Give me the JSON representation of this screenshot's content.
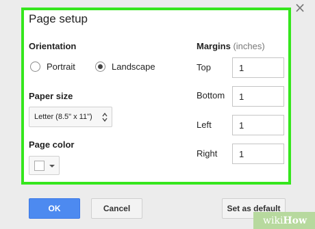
{
  "dialog": {
    "title": "Page setup",
    "close_icon": "close-icon"
  },
  "orientation": {
    "label": "Orientation",
    "options": [
      {
        "label": "Portrait",
        "checked": false
      },
      {
        "label": "Landscape",
        "checked": true
      }
    ]
  },
  "paper_size": {
    "label": "Paper size",
    "selected": "Letter (8.5\" x 11\")"
  },
  "page_color": {
    "label": "Page color",
    "value": "#ffffff"
  },
  "margins": {
    "label": "Margins",
    "unit": "(inches)",
    "fields": [
      {
        "label": "Top",
        "value": "1"
      },
      {
        "label": "Bottom",
        "value": "1"
      },
      {
        "label": "Left",
        "value": "1"
      },
      {
        "label": "Right",
        "value": "1"
      }
    ]
  },
  "buttons": {
    "ok": "OK",
    "cancel": "Cancel",
    "set_default": "Set as default"
  },
  "watermark": {
    "wiki": "wiki",
    "how": "How"
  },
  "colors": {
    "highlight": "#35e61d",
    "primary_button": "#4d8af0",
    "dialog_background": "#ececec"
  }
}
